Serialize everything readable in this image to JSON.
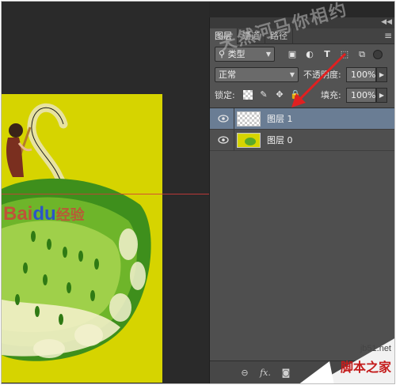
{
  "panel": {
    "tabs": [
      {
        "label": "图层",
        "active": true
      },
      {
        "label": "通道",
        "active": false
      },
      {
        "label": "路径",
        "active": false
      }
    ],
    "filter": {
      "prefix_icon": "search-icon",
      "label": "类型"
    },
    "filter_icons": [
      "image-filter-icon",
      "adjustment-filter-icon",
      "text-filter-icon",
      "shape-filter-icon",
      "smart-object-filter-icon"
    ],
    "blend_mode": "正常",
    "opacity_label": "不透明度:",
    "opacity_value": "100%",
    "lock_label": "锁定:",
    "lock_icons": [
      "lock-transparency-icon",
      "lock-pixels-icon",
      "lock-position-icon",
      "lock-all-icon"
    ],
    "fill_label": "填充:",
    "fill_value": "100%",
    "layers": [
      {
        "name": "图层 1",
        "visible": true,
        "selected": true,
        "thumb": "transparent"
      },
      {
        "name": "图层 0",
        "visible": true,
        "selected": false,
        "thumb": "image"
      }
    ],
    "bottom_icons": [
      "link-layers-icon",
      "fx-icon",
      "layer-mask-icon"
    ]
  },
  "watermarks": {
    "top": "天然河马你相约",
    "baidu_latin": "Bai",
    "baidu_paw": "du",
    "baidu_zh": "经验",
    "site_domain": "jb51.net",
    "site_name": "脚本之家"
  },
  "colors": {
    "canvas": "#d6d400",
    "selected_layer": "#6a7d94",
    "guide": "#d23a3a",
    "annotation_arrow": "#e02020"
  }
}
